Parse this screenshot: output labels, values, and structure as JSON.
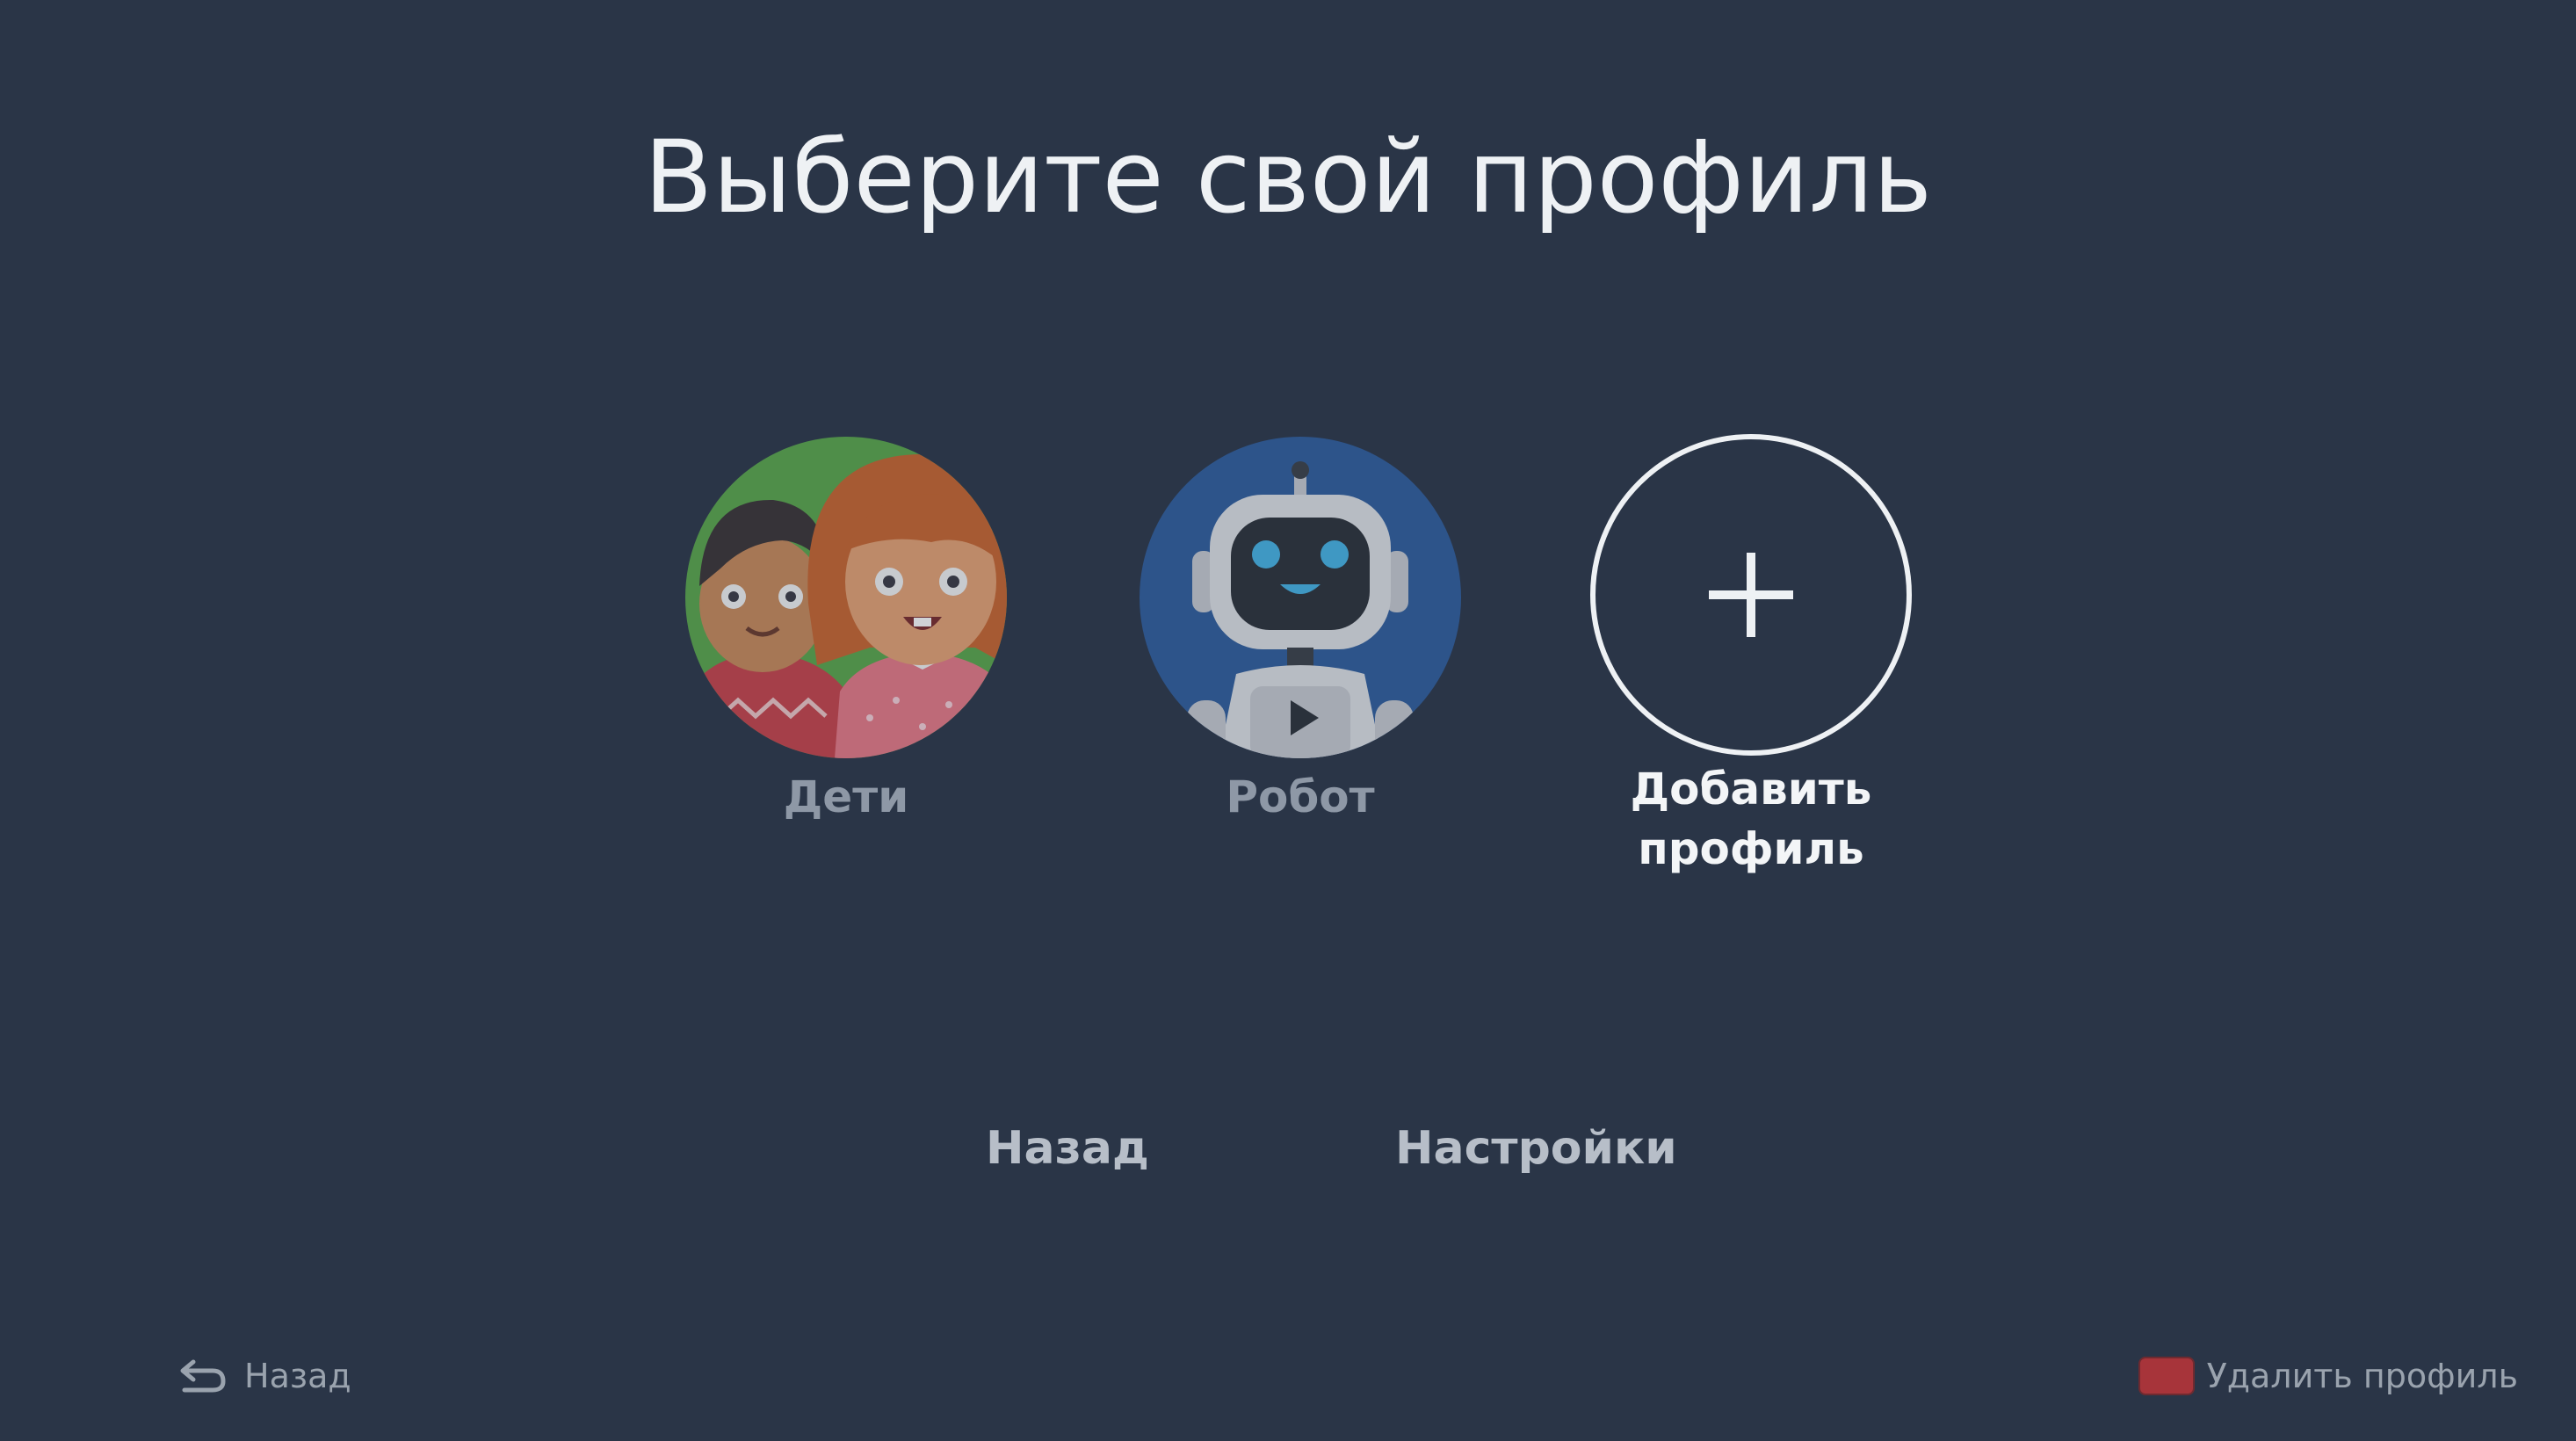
{
  "screen": {
    "title": "Выберите свой профиль"
  },
  "profiles": [
    {
      "name": "Дети",
      "avatar": "kids-avatar"
    },
    {
      "name": "Робот",
      "avatar": "robot-avatar"
    }
  ],
  "add_profile": {
    "label": "Добавить\nпрофиль",
    "icon": "plus-icon"
  },
  "nav": {
    "back_label": "Назад",
    "settings_label": "Настройки"
  },
  "hints": {
    "back_label": "Назад",
    "back_icon": "back-arrow-icon",
    "delete_label": "Удалить профиль",
    "delete_key_color": "#a7343a"
  },
  "colors": {
    "background": "#2a3547",
    "text_primary": "#eef1f4",
    "text_dim": "#8e98a6"
  }
}
